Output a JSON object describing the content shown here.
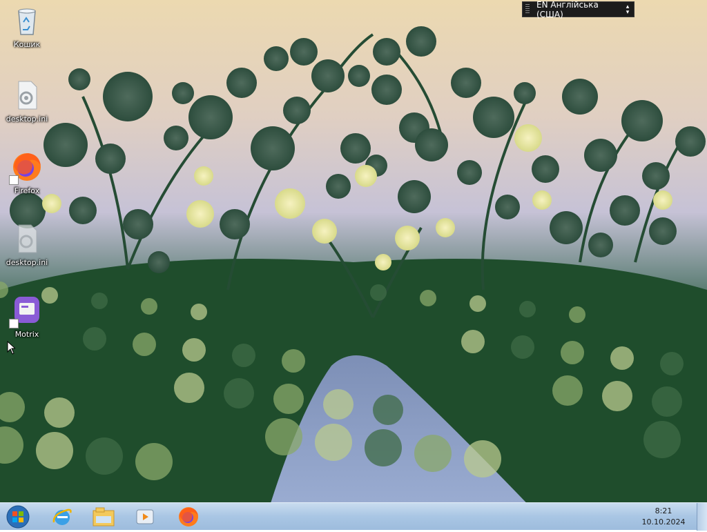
{
  "desktop": {
    "icons": [
      {
        "label": "Кошик",
        "icon": "recycle-bin-icon"
      },
      {
        "label": "desktop.ini",
        "icon": "settings-file-icon"
      },
      {
        "label": "Firefox",
        "icon": "firefox-icon"
      },
      {
        "label": "desktop.ini",
        "icon": "settings-file-icon"
      },
      {
        "label": "Motrix",
        "icon": "motrix-icon"
      }
    ]
  },
  "language_bar": {
    "text": "EN Англійська (США)"
  },
  "taskbar": {
    "start_icon": "windows-start-orb-icon",
    "pinned": [
      {
        "icon": "internet-explorer-icon"
      },
      {
        "icon": "file-explorer-icon"
      },
      {
        "icon": "media-player-icon"
      },
      {
        "icon": "firefox-icon"
      }
    ],
    "clock": {
      "time": "8:21",
      "date": "10.10.2024"
    }
  },
  "colors": {
    "sky_top": "#e9d7b2",
    "sky_mid": "#c8c3d6",
    "foliage_dark": "#1d4a2a",
    "path": "#8fa3c9",
    "taskbar": "#b3cce6"
  }
}
